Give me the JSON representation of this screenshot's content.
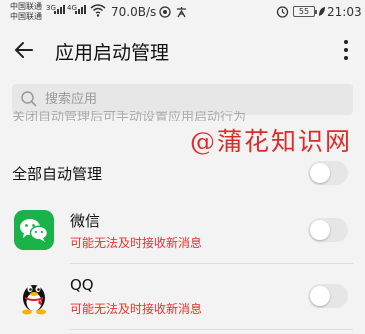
{
  "status_bar": {
    "carrier_1": "中国联通",
    "carrier_2": "中国联通",
    "net_1": "3G",
    "net_2": "4G",
    "speed": "70.0B/s",
    "battery": "55",
    "time": "21:03"
  },
  "app_bar": {
    "title": "应用启动管理"
  },
  "search": {
    "placeholder": "搜索应用"
  },
  "description": "关闭自动管理后可手动设置应用启动行为",
  "watermark": "@蒲花知识网",
  "auto_manage": {
    "label": "全部自动管理",
    "enabled": false
  },
  "apps": [
    {
      "name": "微信",
      "warning": "可能无法及时接收新消息",
      "icon": "wechat-icon",
      "auto": false
    },
    {
      "name": "QQ",
      "warning": "可能无法及时接收新消息",
      "icon": "qq-penguin-icon",
      "auto": false
    }
  ],
  "colors": {
    "warning": "#e0362b",
    "wechat_green": "#1ab34a",
    "watermark": "#e02a2a"
  }
}
